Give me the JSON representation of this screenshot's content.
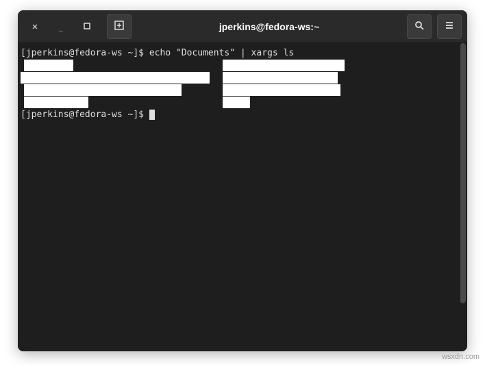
{
  "titlebar": {
    "title": "jperkins@fedora-ws:~",
    "close_icon": "✕",
    "minimize_icon": "—",
    "maximize_icon": "▢",
    "newtab_icon": "⊞",
    "search_icon": "search",
    "menu_icon": "≡"
  },
  "terminal": {
    "line1_prompt": "[jperkins@fedora-ws ~]$ ",
    "line1_cmd": "echo \"Documents\" | xargs ls",
    "line6_prompt": "[jperkins@fedora-ws ~]$ "
  },
  "watermark": "wsxdn.com"
}
